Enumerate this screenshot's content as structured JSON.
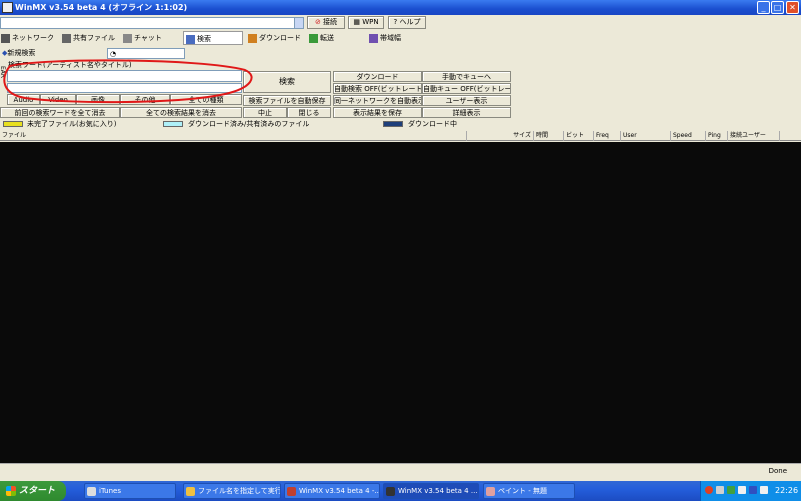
{
  "window": {
    "title": "WinMX v3.54 beta 4  (オフライン 1:1:02)"
  },
  "top_buttons": [
    "接続",
    "WPN",
    "ヘルプ"
  ],
  "tabs": [
    "ネットワーク",
    "共有ファイル",
    "チャット",
    "検索",
    "ダウンロード",
    "転送",
    "帯域幅"
  ],
  "panel": {
    "label": "新規検索",
    "search_hint": "検索ワード(アーティスト名やタイトル)"
  },
  "filter_buttons": [
    "Audio",
    "Video",
    "画像",
    "その他",
    "全ての種類"
  ],
  "search_button": "検索",
  "mid_buttons": [
    "前回の検索ワードを全て消去",
    "全ての検索結果を消去",
    "検索ファイルを自動保存",
    "中止",
    "閉じる"
  ],
  "right_buttons": [
    "ダウンロード",
    "自動検索 OFF(ビットレート)",
    "同一ネットワークを自動表示",
    "表示結果を保存",
    "手動でキューへ",
    "自動キュー OFF(ビットレート)",
    "ユーザー表示",
    "詳細表示"
  ],
  "side_label": "EAR",
  "legend": [
    {
      "text": "未完了ファイル(お気に入り)",
      "color": "#e8e020"
    },
    {
      "text": "ダウンロード済み/共有済みのファイル",
      "color": "#aef0f8"
    },
    {
      "text": "ダウンロード中",
      "color": "#1e3f7a"
    }
  ],
  "columns": [
    "ファイル",
    "サイズ",
    "時間",
    "ビット",
    "Freq",
    "User",
    "Speed",
    "Ping",
    "接続ユーザー"
  ],
  "status": {
    "right": "Done"
  },
  "taskbar": {
    "start": "スタート",
    "tasks": [
      "iTunes",
      "ファイル名を指定して実行",
      "WinMX v3.54 beta 4 -...",
      "WinMX v3.54 beta 4 ...",
      "ペイント - 無題"
    ],
    "clock": "22:26"
  }
}
